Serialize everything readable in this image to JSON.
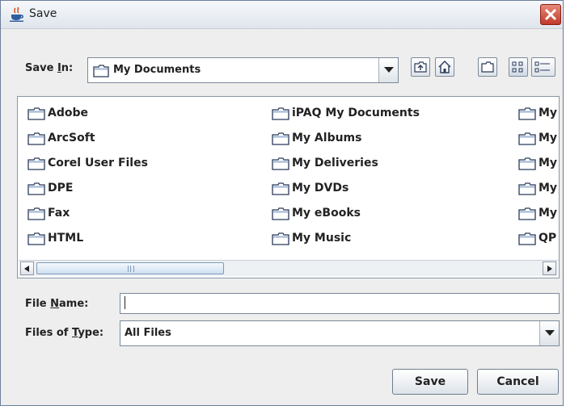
{
  "window": {
    "title": "Save",
    "close_icon": "close-icon",
    "app_icon": "java-cup-icon"
  },
  "save_in": {
    "label_pre": "Save ",
    "label_mnemonic": "I",
    "label_post": "n:",
    "selected": "My Documents",
    "selected_icon": "folder-icon"
  },
  "toolbar": [
    {
      "name": "up-one-level-button",
      "icon": "up-folder-icon"
    },
    {
      "name": "home-button",
      "icon": "home-icon"
    },
    {
      "name": "create-new-folder-button",
      "icon": "new-folder-icon"
    },
    {
      "name": "list-view-button",
      "icon": "list-view-icon"
    },
    {
      "name": "details-view-button",
      "icon": "details-view-icon"
    }
  ],
  "files": {
    "col1": [
      "Adobe",
      "ArcSoft",
      "Corel User Files",
      "DPE",
      "Fax",
      "HTML"
    ],
    "col2": [
      "iPAQ My Documents",
      "My Albums",
      "My Deliveries",
      "My DVDs",
      "My eBooks",
      "My Music"
    ],
    "col3": [
      "My",
      "My",
      "My",
      "My",
      "My",
      "QP"
    ]
  },
  "file_name": {
    "label_pre": "File ",
    "label_mnemonic": "N",
    "label_post": "ame:",
    "value": ""
  },
  "file_type": {
    "label_pre": "Files of ",
    "label_mnemonic": "T",
    "label_post": "ype:",
    "selected": "All Files"
  },
  "buttons": {
    "save": "Save",
    "cancel": "Cancel"
  }
}
